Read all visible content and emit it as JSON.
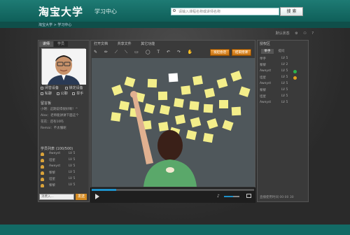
{
  "header": {
    "logo": "淘宝大学",
    "subtitle": "学习中心",
    "search_placeholder": "请输入课程名称或讲师名称",
    "search_button": "搜 索",
    "breadcrumb": "淘宝大学 > 学习中心"
  },
  "top_tools": {
    "default_status": "默认状态"
  },
  "left": {
    "tabs": [
      "讲师",
      "学员"
    ],
    "checks": [
      [
        "闭音设备",
        "锁定设备"
      ],
      [
        "私聊",
        "公聊",
        "举手"
      ]
    ],
    "msg_title": "留言板",
    "messages": [
      "小明：这期说得很好啊！^",
      "Alex：老师能讲讲下面这个",
      "花花：还有10吗",
      "Remai：不太懂呢"
    ],
    "student_title": "学员列表 (100/500)",
    "students": [
      {
        "name": "Aweyst",
        "lv": "LV 5"
      },
      {
        "name": "坦星",
        "lv": "LV 5"
      },
      {
        "name": "Aweyst",
        "lv": "LV 5"
      },
      {
        "name": "黎黎",
        "lv": "LV 5"
      },
      {
        "name": "坦星",
        "lv": "LV 5"
      },
      {
        "name": "黎黎",
        "lv": "LV 5"
      }
    ],
    "input_placeholder": "消费入...",
    "send_label": "发送"
  },
  "center": {
    "menus": [
      "打开文档",
      "共享文件",
      "其它功能"
    ],
    "tools": [
      "✎",
      "✏",
      "⟋",
      "⟍",
      "▭",
      "◯",
      "T",
      "↶",
      "↷",
      "✋"
    ],
    "btn_join": "发起会话",
    "btn_end": "结束授课",
    "progress_pct": 0.15,
    "volume_pct": 0.6,
    "time": "00:00"
  },
  "right": {
    "title": "授权区",
    "tabs": [
      "举手",
      "提问"
    ],
    "members": [
      {
        "name": "举手",
        "lv": "LV 5",
        "dot": ""
      },
      {
        "name": "黎黎",
        "lv": "LV 2",
        "dot": ""
      },
      {
        "name": "Aweyst",
        "lv": "LV 5",
        "dot": "#2bb24c"
      },
      {
        "name": "坦星",
        "lv": "LV 5",
        "dot": "#e0a020"
      },
      {
        "name": "Aweyst",
        "lv": "LV 5",
        "dot": ""
      },
      {
        "name": "黎黎",
        "lv": "LV 5",
        "dot": ""
      },
      {
        "name": "坦星",
        "lv": "LV 5",
        "dot": ""
      },
      {
        "name": "Aweyst",
        "lv": "LV 5",
        "dot": ""
      }
    ],
    "footer": "直播使用时间 00:00 30"
  }
}
